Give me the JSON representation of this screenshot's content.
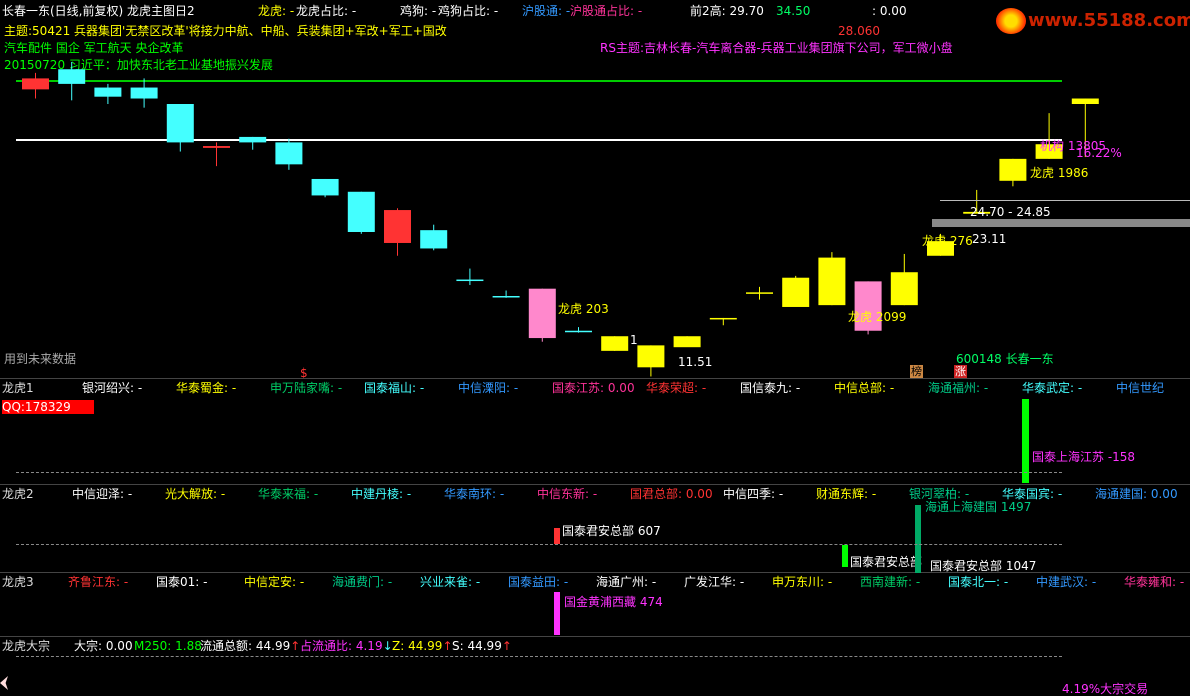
{
  "colors": {
    "up": "#ff3333",
    "down": "#44ffff",
    "yellow": "#ffff00",
    "pink": "#ff88cc",
    "green": "#00cc00",
    "white": "#ffffff",
    "magenta": "#ff33ff",
    "teal": "#00cc88"
  },
  "header": {
    "title": "长春一东(日线,前复权) 龙虎主图日2",
    "longhu": "龙虎: -",
    "longhu_pct": "龙虎占比: -",
    "jigou": "鸡狗: -",
    "jigou_pct": "鸡狗占比: -",
    "hgt": "沪股通: -",
    "hgt_pct": "沪股通占比: -",
    "prev2high": "前2高: 29.70",
    "val2": "34.50",
    "val3": ": 0.00"
  },
  "watermark": "www.55188.com",
  "main": {
    "theme": "主题:50421 兵器集团'无禁区改革'将接力中航、中船、兵装集团+军改+军工+国改",
    "concept": "汽车配件 国企 军工航天 央企改革",
    "news": "20150720 习近平：加快东北老工业基地振兴发展",
    "rs_theme": "RS主题:吉林长春-汽车离合器-兵器工业集团旗下公司，军工微小盘",
    "price_high": "28.060",
    "range": "24.70 - 24.85",
    "low_price": "11.51",
    "low_label_left": "1",
    "future": "用到未来数据",
    "stock": "600148 长春一东",
    "dollar": "$",
    "badge1": "榜",
    "badge2": "涨",
    "lh_labels": [
      {
        "text": "龙虎 203"
      },
      {
        "text": "龙虎 2099"
      },
      {
        "text": "龙虎 276"
      },
      {
        "text": "23.11"
      },
      {
        "text": "龙虎 1986"
      },
      {
        "text": "机构 13805"
      },
      {
        "text": "16.22%"
      }
    ]
  },
  "panel1": {
    "label": "龙虎1",
    "qq": "QQ:178329",
    "items": [
      "银河绍兴: -",
      "华泰蜀金: -",
      "申万陆家嘴: -",
      "国泰福山: -",
      "中信溧阳: -",
      "国泰江苏: 0.00",
      "华泰荣超: -",
      "国信泰九: -",
      "中信总部: -",
      "海通福州: -",
      "华泰武定: -",
      "中信世纪"
    ],
    "bar_label": "国泰上海江苏 -158"
  },
  "panel2": {
    "label": "龙虎2",
    "items": [
      "中信迎泽: -",
      "光大解放: -",
      "华泰来福: -",
      "中建丹棱: -",
      "华泰南环: -",
      "中信东新: -",
      "国君总部: 0.00",
      "中信四季: -",
      "财通东辉: -",
      "银河翠柏: -",
      "华泰国宾: -",
      "海通建国: 0.00"
    ],
    "bar_labels": [
      "国泰君安总部 607",
      "国泰君安总部",
      "国泰君安总部 1047",
      "海通上海建国 1497"
    ]
  },
  "panel3": {
    "label": "龙虎3",
    "items": [
      "齐鲁江东: -",
      "国泰01: -",
      "中信定安: -",
      "海通费门: -",
      "兴业来雀: -",
      "国泰益田: -",
      "海通广州: -",
      "广发江华: -",
      "申万东川: -",
      "西南建新: -",
      "国泰北一: -",
      "中建武汉: -",
      "华泰雍和: -"
    ],
    "bar_label": "国金黄浦西藏 474"
  },
  "panel4": {
    "label": "龙虎大宗",
    "dazong": "大宗: 0.00",
    "m250": "M250: 1.88",
    "ltzj": "流通总额: 44.99",
    "zltb": "占流通比: 4.19",
    "z": "Z: 44.99",
    "s": "S: 44.99",
    "bottom_note": "4.19%大宗交易"
  },
  "chart_data": {
    "type": "candlestick",
    "candles": [
      {
        "o": 25.3,
        "h": 26.2,
        "l": 24.8,
        "c": 25.9
      },
      {
        "o": 26.4,
        "h": 26.8,
        "l": 24.7,
        "c": 25.6
      },
      {
        "o": 25.4,
        "h": 25.6,
        "l": 24.5,
        "c": 24.9
      },
      {
        "o": 25.4,
        "h": 25.9,
        "l": 24.3,
        "c": 24.8
      },
      {
        "o": 24.5,
        "h": 24.5,
        "l": 21.9,
        "c": 22.4
      },
      {
        "o": 22.1,
        "h": 22.4,
        "l": 21.1,
        "c": 22.2
      },
      {
        "o": 22.7,
        "h": 22.7,
        "l": 22.0,
        "c": 22.4
      },
      {
        "o": 22.4,
        "h": 22.6,
        "l": 20.9,
        "c": 21.2
      },
      {
        "o": 20.4,
        "h": 20.4,
        "l": 19.4,
        "c": 19.5
      },
      {
        "o": 19.7,
        "h": 19.7,
        "l": 17.4,
        "c": 17.5
      },
      {
        "o": 16.9,
        "h": 18.8,
        "l": 16.2,
        "c": 18.7
      },
      {
        "o": 17.6,
        "h": 17.9,
        "l": 16.5,
        "c": 16.6
      },
      {
        "o": 14.9,
        "h": 15.5,
        "l": 14.6,
        "c": 14.9
      },
      {
        "o": 14.0,
        "h": 14.3,
        "l": 13.9,
        "c": 14.0
      },
      {
        "o": 14.4,
        "h": 14.4,
        "l": 11.5,
        "c": 11.7
      },
      {
        "o": 12.1,
        "h": 12.3,
        "l": 12.0,
        "c": 12.1
      },
      {
        "o": 11.8,
        "h": 11.8,
        "l": 11.0,
        "c": 11.0
      },
      {
        "o": 11.3,
        "h": 11.3,
        "l": 9.6,
        "c": 10.1
      },
      {
        "o": 11.8,
        "h": 11.8,
        "l": 11.3,
        "c": 11.2
      },
      {
        "o": 12.8,
        "h": 12.8,
        "l": 12.4,
        "c": 12.8
      },
      {
        "o": 14.2,
        "h": 14.5,
        "l": 13.8,
        "c": 14.2
      },
      {
        "o": 15.0,
        "h": 15.1,
        "l": 13.5,
        "c": 13.4
      },
      {
        "o": 13.5,
        "h": 16.4,
        "l": 13.5,
        "c": 16.1
      },
      {
        "o": 14.8,
        "h": 14.8,
        "l": 11.9,
        "c": 12.1
      },
      {
        "o": 13.5,
        "h": 16.3,
        "l": 13.5,
        "c": 15.3
      },
      {
        "o": 16.2,
        "h": 17.4,
        "l": 16.2,
        "c": 17.0
      },
      {
        "o": 18.6,
        "h": 19.8,
        "l": 18.6,
        "c": 18.5
      },
      {
        "o": 21.5,
        "h": 21.5,
        "l": 20.0,
        "c": 20.3
      },
      {
        "o": 21.5,
        "h": 24.0,
        "l": 21.5,
        "c": 22.3
      },
      {
        "o": 24.8,
        "h": 24.8,
        "l": 21.6,
        "c": 24.5
      }
    ]
  }
}
